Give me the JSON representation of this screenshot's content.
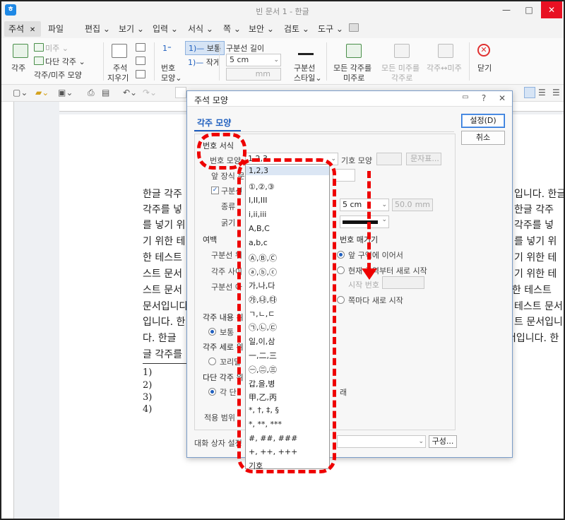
{
  "app": {
    "title": "빈 문서 1 - 한글",
    "logo": "ㅎ",
    "window_controls": [
      "—",
      "□",
      "✕"
    ]
  },
  "menubar": {
    "active_tab": "주석",
    "active_tab_close": "✕",
    "items": [
      "파일",
      "편집 ⌄",
      "보기 ⌄",
      "입력 ⌄",
      "서식 ⌄",
      "쪽 ⌄",
      "보안 ⌄",
      "검토 ⌄",
      "도구 ⌄"
    ]
  },
  "ribbon": {
    "footnote_big": "각주",
    "endnote": "미주 ⌄",
    "multi_footnote": "다단 각주 ⌄",
    "note_shape": "각주/미주 모양",
    "comment_top": "주석",
    "comment_bottom": "지우기",
    "number_shape_top": "번호",
    "number_shape_bottom": "모양⌄",
    "size_normal": "보통",
    "size_small": "작게",
    "sep_length_label": "구분선 길이",
    "sep_length_value": "5 cm",
    "sep_length_unit": "mm",
    "sep_style_top": "구분선",
    "sep_style_bottom": "스타일⌄",
    "all_foot_top": "모든 각주를",
    "all_foot_bottom": "미주로",
    "all_end_top": "모든 미주를",
    "all_end_bottom": "각주로",
    "swap": "각주↔미주",
    "close": "닫기"
  },
  "document": {
    "lines": [
      "한글 각주",
      "각주를 넣",
      "를 넣기 위",
      "기 위한 테",
      "한 테스트",
      "스트 문서",
      "스트 문서",
      "문서입니다",
      "입니다. 한",
      "다. 한글 ",
      "글 각주를"
    ],
    "right_fragments": [
      "입니다. 한글",
      "한글 각주",
      "각주를 넣",
      "를 넣기 위",
      "기 위한 테",
      "기 위한 테",
      "위한 테스트",
      "테스트 문서",
      "트 문서입니",
      "서입니다. 한"
    ],
    "notes": [
      "1)",
      "2)",
      "3)",
      "4)"
    ]
  },
  "dialog": {
    "title": "주석 모양",
    "help": "?",
    "close": "✕",
    "tab": "각주 모양",
    "ok": "설정(D)",
    "cancel": "취소",
    "number_format_section": "번호 서식",
    "number_shape_label": "번호 모양",
    "number_shape_value": "1,2,3",
    "symbol_shape_label": "기호 모양",
    "char_map_button": "문자표...",
    "prefix_label": "앞 장식 문",
    "separator_check": "구분선",
    "kind_label": "종류",
    "length_value": "5 cm",
    "length_mm": "50.0",
    "length_unit": "mm",
    "thickness_label": "굵기",
    "margin_section": "여백",
    "margin_above": "구분선 위",
    "margin_between": "각주 사이",
    "margin_below": "구분선 아",
    "numbering_section": "번호 매기기",
    "numbering_continue": "앞 구역에 이어서",
    "numbering_restart_section": "현재 구역부터 새로 시작",
    "numbering_start": "시작 번호",
    "numbering_restart_page": "쪽마다 새로 시작",
    "content_position_section": "각주 내용 위",
    "content_normal": "보통",
    "vertical_section": "각주 세로 위",
    "vertical_bottom": "꼬리말",
    "multi_section": "다단 각주 위",
    "multi_each": "각 단",
    "multi_right": "래",
    "apply_range": "적용 범위",
    "dialog_settings": "대화 상자 설정",
    "compose_button": "구성..."
  },
  "dropdown": {
    "options": [
      "1,2,3",
      "①,②,③",
      "I,II,III",
      "i,ii,iii",
      "A,B,C",
      "a,b,c",
      "Ⓐ,Ⓑ,Ⓒ",
      "ⓐ,ⓑ,ⓒ",
      "가,나,다",
      "㉮,㉯,㉰",
      "ㄱ,ㄴ,ㄷ",
      "㉠,㉡,㉢",
      "일,이,삼",
      "一,二,三",
      "㊀,㊁,㊂",
      "갑,을,병",
      "甲,乙,丙",
      "*, †, ‡, §",
      "*, **, ***",
      "#, ##, ###",
      "+, ++, +++",
      "기호"
    ]
  },
  "colors": {
    "annotation": "#e00000",
    "accent": "#1f5fbf"
  }
}
